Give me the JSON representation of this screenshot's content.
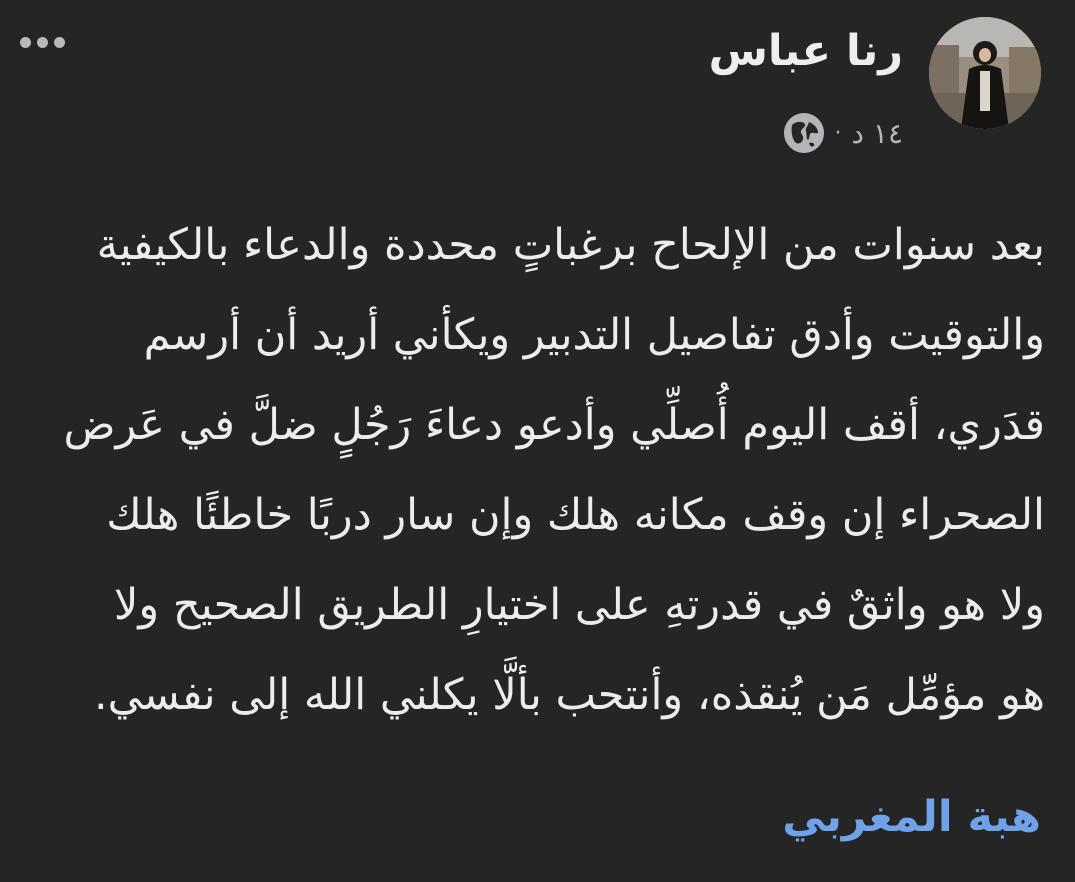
{
  "post": {
    "author_name": "رنا عباس",
    "timestamp": "١٤ د",
    "separator": "·",
    "privacy_icon": "globe-icon",
    "more_icon": "more-options-icon",
    "body": "بعد سنوات من الإلحاح برغباتٍ محددة والدعاء بالكيفية\nوالتوقيت وأدق تفاصيل التدبير ويكأني أريد أن أرسم\nقدَري، أقف اليوم أُصلِّي وأدعو دعاءَ رَجُلٍ ضلَّ في عَرض\nالصحراء إن وقف مكانه هلك وإن سار دربًا خاطئًا هلك\nولا  هو واثقٌ في قدرتهِ على اختيارِ الطريق الصحيح ولا\nهو مؤمِّل مَن يُنقذه، وأنتحب بألَّا يكلني الله إلى نفسي.",
    "signature": "هبة المغربي"
  },
  "colors": {
    "background": "#252525",
    "text": "#ececec",
    "muted": "#b3b5b8",
    "link": "#6fa2e9"
  }
}
